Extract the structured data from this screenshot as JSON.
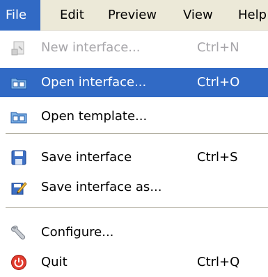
{
  "menubar": {
    "items": [
      {
        "label": "File",
        "active": true
      },
      {
        "label": "Edit",
        "active": false
      },
      {
        "label": "Preview",
        "active": false
      },
      {
        "label": "View",
        "active": false
      },
      {
        "label": "Help",
        "active": false
      }
    ]
  },
  "file_menu": {
    "items": [
      {
        "label": "New interface...",
        "shortcut": "Ctrl+N",
        "icon": "new-interface-icon",
        "disabled": true,
        "highlighted": false
      },
      {
        "label": "Open interface...",
        "shortcut": "Ctrl+O",
        "icon": "open-folder-icon",
        "disabled": false,
        "highlighted": true
      },
      {
        "label": "Open template...",
        "shortcut": "",
        "icon": "open-folder-icon",
        "disabled": false,
        "highlighted": false
      },
      {
        "label": "Save interface",
        "shortcut": "Ctrl+S",
        "icon": "floppy-disk-icon",
        "disabled": false,
        "highlighted": false
      },
      {
        "label": "Save interface as...",
        "shortcut": "",
        "icon": "save-as-pencil-icon",
        "disabled": false,
        "highlighted": false
      },
      {
        "label": "Configure...",
        "shortcut": "",
        "icon": "wrench-icon",
        "disabled": false,
        "highlighted": false
      },
      {
        "label": "Quit",
        "shortcut": "Ctrl+Q",
        "icon": "power-icon",
        "disabled": false,
        "highlighted": false
      }
    ]
  },
  "colors": {
    "highlight": "#316ac5",
    "menubar_bg": "#ece9d8",
    "disabled_text": "#a7a6aa"
  }
}
